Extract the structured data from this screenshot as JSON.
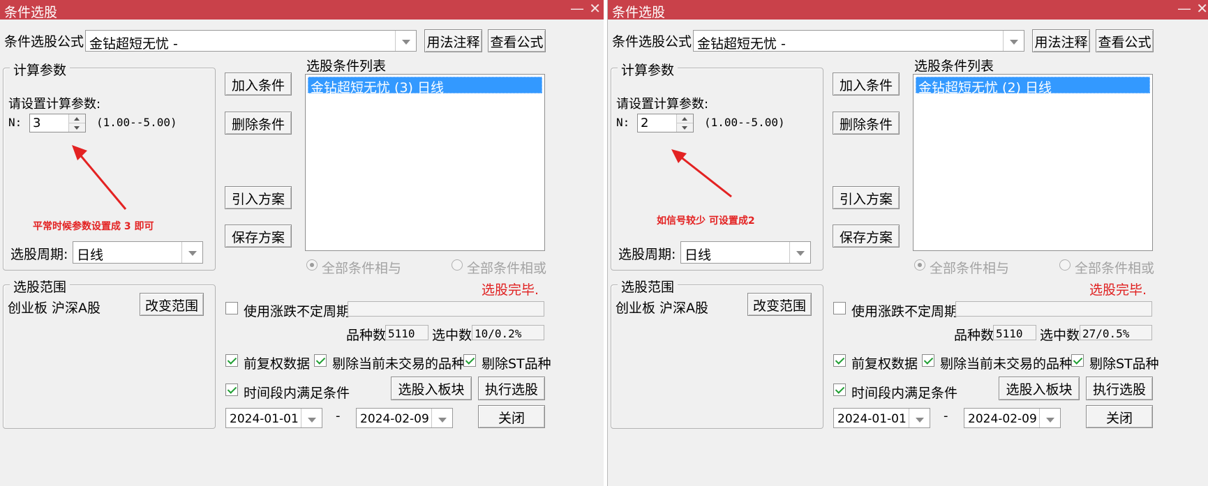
{
  "common": {
    "window_title": "条件选股",
    "min_glyph": "—",
    "close_glyph": "✕",
    "formula_label": "条件选股公式",
    "formula_value": "金钻超短无忧 -",
    "usage_button": "用法注释",
    "view_formula_button": "查看公式",
    "calc_params_title": "计算参数",
    "params_prompt": "请设置计算参数:",
    "n_label": "N:",
    "n_range": "(1.00--5.00)",
    "period_label": "选股周期:",
    "period_value": "日线",
    "add_condition": "加入条件",
    "delete_condition": "删除条件",
    "import_scheme": "引入方案",
    "save_scheme": "保存方案",
    "condition_list_label": "选股条件列表",
    "radio_and": "全部条件相与",
    "radio_or": "全部条件相或",
    "status_done": "选股完毕.",
    "scope_title": "选股范围",
    "scope_value": "创业板 沪深A股",
    "change_scope": "改变范围",
    "use_irregular_period": "使用涨跌不定周期",
    "count_label": "品种数",
    "count_value": "5110",
    "selected_label": "选中数",
    "forward_adjust": "前复权数据",
    "exclude_not_traded": "剔除当前未交易的品种",
    "exclude_st": "剔除ST品种",
    "time_range_condition": "时间段内满足条件",
    "to_block": "选股入板块",
    "execute": "执行选股",
    "close": "关闭",
    "date_start": "2024-01-01",
    "date_dash": "-",
    "date_end": "2024-02-09",
    "accent_title_color": "#c9414a",
    "selection_color": "#3399ff",
    "annotation_color": "#e32222"
  },
  "left": {
    "n_value": "3",
    "condition_item": "金钻超短无忧 (3) 日线",
    "selected_value": "10/0.2%",
    "annotation": "平常时候参数设置成 3 即可"
  },
  "right": {
    "n_value": "2",
    "condition_item": "金钻超短无忧 (2) 日线",
    "selected_value": "27/0.5%",
    "annotation": "如信号较少 可设置成2"
  }
}
